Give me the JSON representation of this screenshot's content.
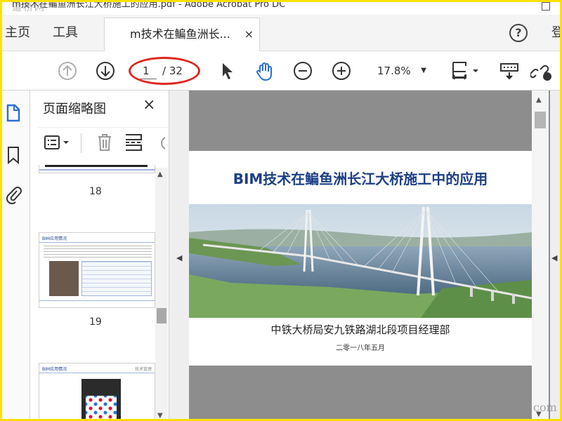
{
  "window": {
    "title": "m技术在鳊鱼洲长江大桥施工的应用.pdf - Adobe Acrobat Pro DC",
    "watermark": "道桥网"
  },
  "nav": {
    "home_label": "主页",
    "tools_label": "工具",
    "doc_tab_label": "m技术在鳊鱼洲长...",
    "close_glyph": "×",
    "help_glyph": "?",
    "signin_label": "登"
  },
  "toolbar": {
    "current_page": "1",
    "total_pages": "/ 32",
    "zoom_value": "17.8%",
    "zoom_caret": "▼"
  },
  "panel": {
    "title": "页面缩略图",
    "close_glyph": "×",
    "page_numbers": [
      "18",
      "19"
    ],
    "thumb19_header": "BIM应用情况",
    "thumb20_header": "BIM应用情况",
    "thumb20_right": "技术管理"
  },
  "document": {
    "title": "BIM技术在鳊鱼洲长江大桥施工中的应用",
    "org": "中铁大桥局安九铁路湖北段项目经理部",
    "date": "二零一八年五月"
  },
  "corner_watermark": "com",
  "colors": {
    "accent_blue": "#1d3f85",
    "highlight_red": "#e0261f",
    "frame_yellow": "#ffe100"
  }
}
